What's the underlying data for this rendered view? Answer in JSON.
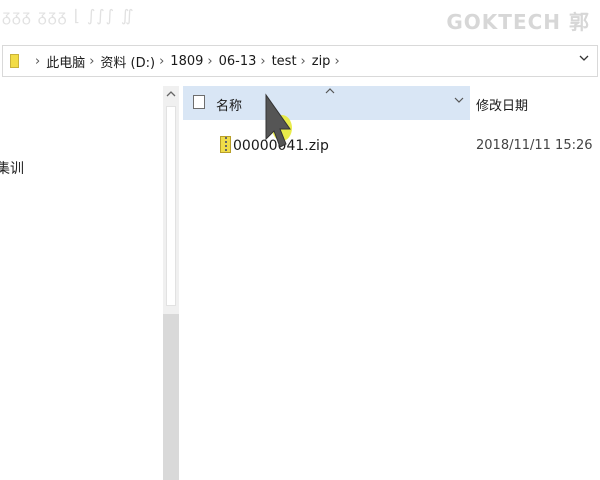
{
  "watermark": {
    "left_text": "ᵹᵹᵹ ᵹᵹᵹ ⌊ ∫∫∫ ∬",
    "right_text": "GOKTECH 郭"
  },
  "address_bar": {
    "crumbs": [
      "此电脑",
      "资料 (D:)",
      "1809",
      "06-13",
      "test",
      "zip"
    ],
    "separator": "›"
  },
  "nav": {
    "partial_label": "集训"
  },
  "columns": {
    "name": "名称",
    "date": "修改日期"
  },
  "files": [
    {
      "name": "00000041.zip",
      "modified": "2018/11/11 15:26"
    }
  ],
  "colors": {
    "header_hover": "#d9e6f5",
    "folder": "#f2dc46",
    "cursor_halo": "#e7ea36"
  },
  "icons": [
    "folder-icon",
    "zip-file-icon",
    "chevron-down-icon",
    "sort-up-icon",
    "scroll-up-icon",
    "mouse-cursor-icon"
  ]
}
